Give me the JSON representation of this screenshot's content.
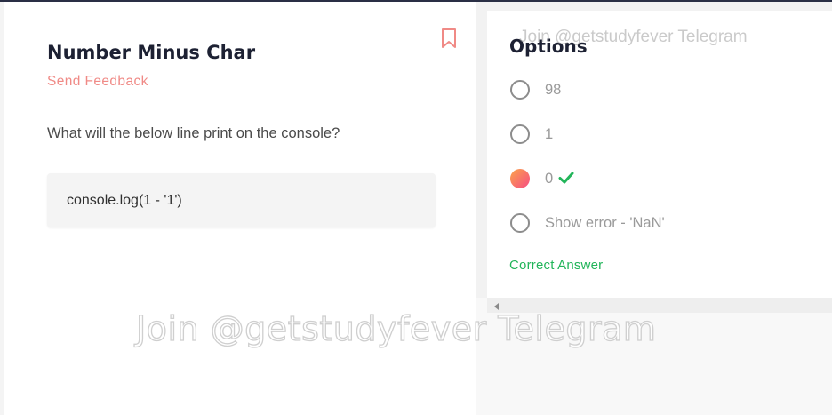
{
  "question": {
    "title": "Number Minus Char",
    "feedback_label": "Send Feedback",
    "prompt": "What will the below line print on the console?",
    "code": "console.log(1 - '1')"
  },
  "options_panel": {
    "title": "Options",
    "options": [
      {
        "label": "98",
        "selected": false
      },
      {
        "label": "1",
        "selected": false
      },
      {
        "label": "0",
        "selected": true,
        "correct": true
      },
      {
        "label": "Show error - 'NaN'",
        "selected": false
      }
    ],
    "result_text": "Correct Answer"
  },
  "watermarks": {
    "small": "Join @getstudyfever Telegram",
    "large": "Join @getstudyfever Telegram"
  },
  "icons": {
    "bookmark": "bookmark-icon",
    "check": "check-icon",
    "scroll_left": "scroll-left-arrow-icon"
  },
  "colors": {
    "accent": "#f08a86",
    "correct": "#22b55a",
    "radio_selected_from": "#fba34a",
    "radio_selected_to": "#f64d84",
    "heading": "#1d2133"
  }
}
